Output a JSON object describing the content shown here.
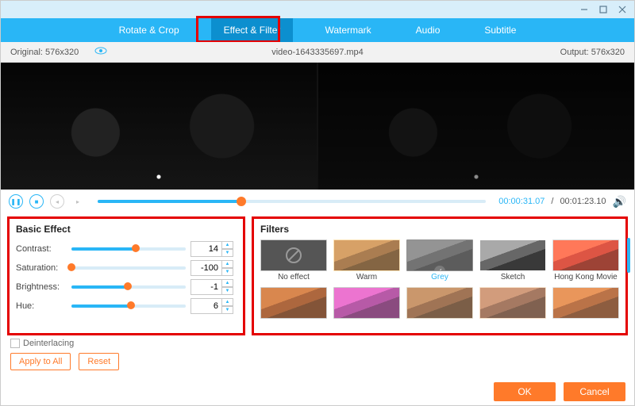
{
  "tabs": [
    "Rotate & Crop",
    "Effect & Filter",
    "Watermark",
    "Audio",
    "Subtitle"
  ],
  "active_tab_index": 1,
  "infobar": {
    "original_label": "Original: 576x320",
    "filename": "video-1643335697.mp4",
    "output_label": "Output: 576x320"
  },
  "playbar": {
    "current": "00:00:31.07",
    "total": "00:01:23.10",
    "progress_pct": 37
  },
  "basic": {
    "title": "Basic Effect",
    "rows": [
      {
        "label": "Contrast:",
        "value": "14",
        "pct": 56
      },
      {
        "label": "Saturation:",
        "value": "-100",
        "pct": 0
      },
      {
        "label": "Brightness:",
        "value": "-1",
        "pct": 49
      },
      {
        "label": "Hue:",
        "value": "6",
        "pct": 52
      }
    ],
    "deinterlacing": "Deinterlacing",
    "apply": "Apply to All",
    "reset": "Reset"
  },
  "filters": {
    "title": "Filters",
    "items": [
      {
        "label": "No effect",
        "none": true
      },
      {
        "label": "Warm"
      },
      {
        "label": "Grey",
        "selected": true
      },
      {
        "label": "Sketch"
      },
      {
        "label": "Hong Kong Movie"
      },
      {
        "label": ""
      },
      {
        "label": ""
      },
      {
        "label": ""
      },
      {
        "label": ""
      },
      {
        "label": ""
      }
    ]
  },
  "footer": {
    "ok": "OK",
    "cancel": "Cancel"
  }
}
